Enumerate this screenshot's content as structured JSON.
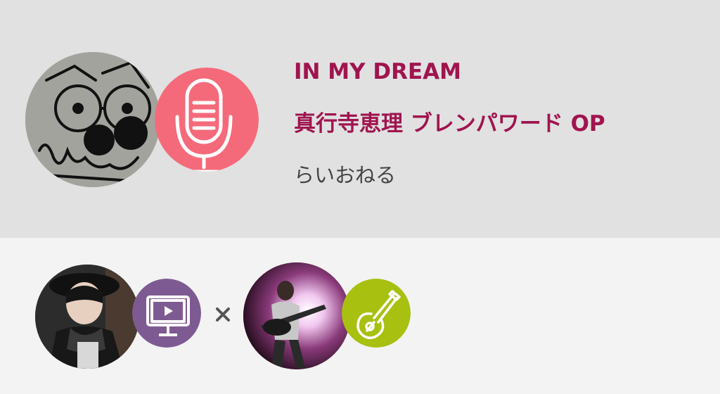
{
  "song": {
    "title": "IN MY DREAM",
    "subtitle": "真行寺恵理 ブレンパワード OP",
    "author": "らいおねる"
  },
  "icons": {
    "main_badge": "microphone-icon",
    "singer_badge": "video-monitor-icon",
    "collab_separator": "times-icon",
    "guitarist_badge": "guitar-icon"
  },
  "colors": {
    "title": "#a0144f",
    "mic_badge": "#f56a7a",
    "video_badge": "#7e5a92",
    "guitar_badge": "#a8c010",
    "header_bg": "#e1e1e1",
    "footer_bg": "#f3f3f3"
  }
}
